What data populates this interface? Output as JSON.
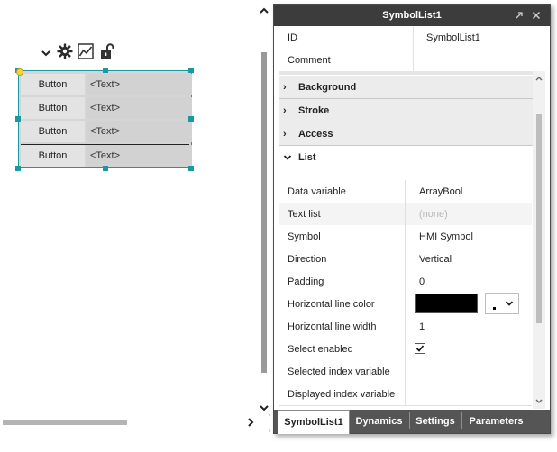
{
  "canvas": {
    "widget_rows": [
      {
        "button": "Button",
        "text": "<Text>"
      },
      {
        "button": "Button",
        "text": "<Text>"
      },
      {
        "button": "Button",
        "text": "<Text>"
      },
      {
        "button": "Button",
        "text": "<Text>"
      }
    ]
  },
  "panel": {
    "title": "SymbolList1",
    "top_rows": [
      {
        "label": "ID",
        "value": "SymbolList1"
      },
      {
        "label": "Comment",
        "value": ""
      }
    ],
    "groups": {
      "background": "Background",
      "stroke": "Stroke",
      "access": "Access",
      "list": "List"
    },
    "list_props": [
      {
        "label": "Data variable",
        "value": "ArrayBool"
      },
      {
        "label": "Text list",
        "value": "(none)"
      },
      {
        "label": "Symbol",
        "value": "HMI Symbol"
      },
      {
        "label": "Direction",
        "value": "Vertical"
      },
      {
        "label": "Padding",
        "value": "0"
      },
      {
        "label": "Horizontal line color",
        "value": ""
      },
      {
        "label": "Horizontal line width",
        "value": "1"
      },
      {
        "label": "Select enabled",
        "value": ""
      },
      {
        "label": "Selected index variable",
        "value": ""
      },
      {
        "label": "Displayed index variable",
        "value": ""
      }
    ],
    "horizontal_line_color": "#000000",
    "select_enabled_checked": true,
    "tabs": [
      "SymbolList1",
      "Dynamics",
      "Settings",
      "Parameters"
    ],
    "active_tab": "SymbolList1"
  },
  "colors": {
    "selection": "#1a9aa0",
    "title_bar": "#3c3c3c",
    "tab_bar": "#555555"
  }
}
